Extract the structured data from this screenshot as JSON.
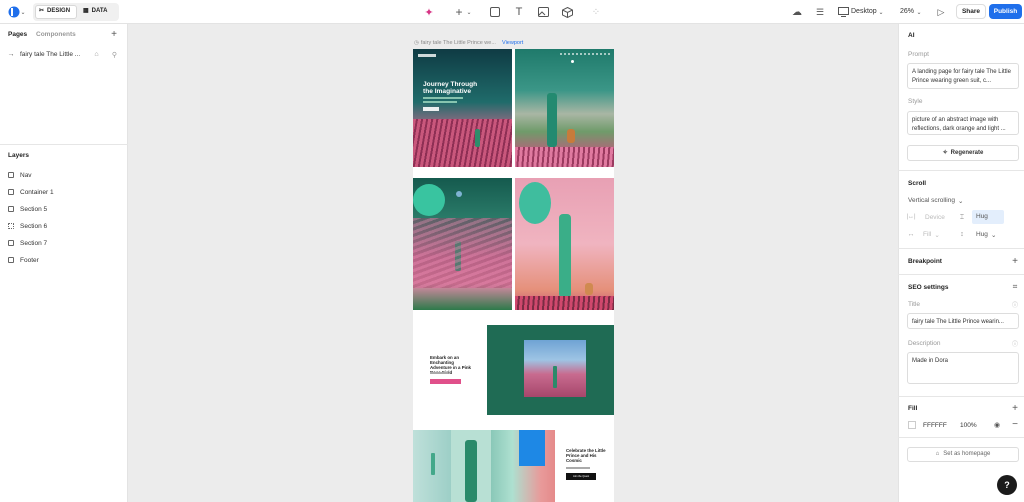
{
  "topbar": {
    "design_label": "DESIGN",
    "data_label": "DATA",
    "device_label": "Desktop",
    "zoom": "26%",
    "share_label": "Share",
    "publish_label": "Publish"
  },
  "left": {
    "tab_pages": "Pages",
    "tab_components": "Components",
    "page_item": "fairy tale The Little ...",
    "layers_title": "Layers",
    "layers": [
      "Nav",
      "Container 1",
      "Section 5",
      "Section 6",
      "Section 7",
      "Footer"
    ]
  },
  "canvas": {
    "frame_label": "fairy tale The Little Prince we...",
    "viewport_label": "Viewport",
    "hero_title": "Journey Through the Imaginative",
    "embark_text": "Embark on an Enchanting Adventure in a Pink Rose Field",
    "celebrate_text": "Celebrate the Little Prince and His Cosmic",
    "celebrate_btn": "Join the Quest"
  },
  "right": {
    "ai_title": "AI",
    "prompt_label": "Prompt",
    "prompt_value": "A landing page for fairy tale The Little Prince wearing green suit, c...",
    "style_label": "Style",
    "style_value": "picture of an abstract image with reflections, dark orange and light ...",
    "regenerate_label": "Regenerate",
    "scroll_title": "Scroll",
    "scroll_value": "Vertical scrolling",
    "device_label": "Device",
    "hug1": "Hug",
    "fill_small": "Fill",
    "hug2": "Hug",
    "breakpoint_title": "Breakpoint",
    "seo_title": "SEO settings",
    "seo_title_label": "Title",
    "seo_title_value": "fairy tale The Little Prince wearin...",
    "desc_label": "Description",
    "desc_value": "Made in Dora",
    "fill_title": "Fill",
    "fill_hex": "FFFFFF",
    "fill_opacity": "100%",
    "homepage_label": "Set as homepage"
  },
  "colors": {
    "accent": "#1f6feb",
    "teal": "#2a9d8f",
    "pink": "#e8a0b4"
  }
}
